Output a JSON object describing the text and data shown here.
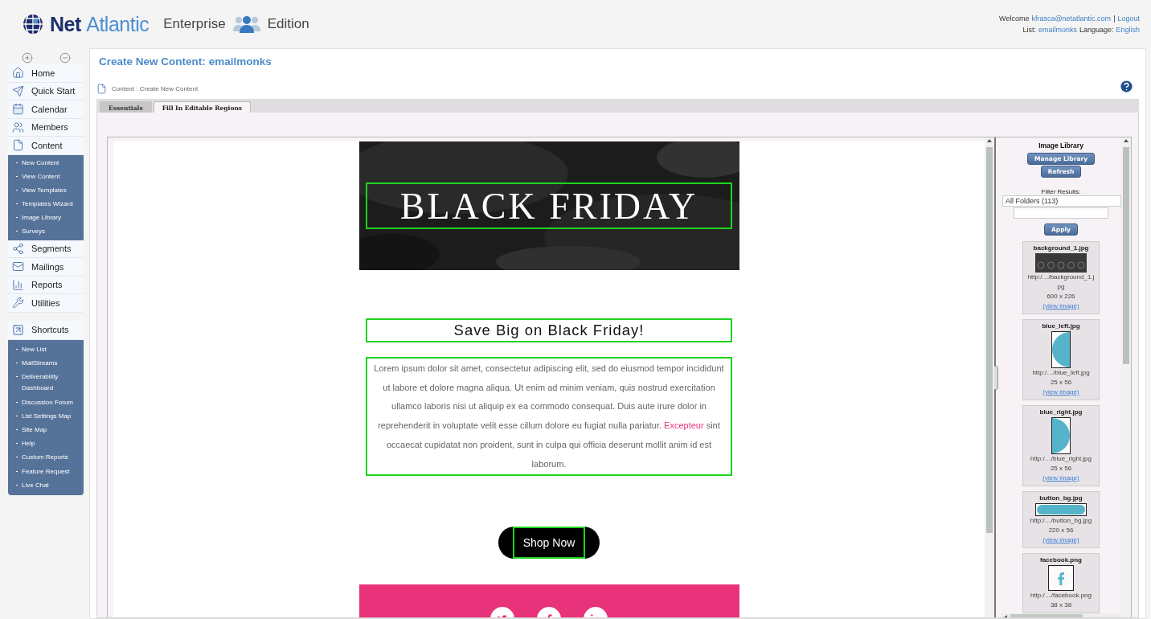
{
  "header": {
    "logo": {
      "first": "Net",
      "second": "Atlantic"
    },
    "edition": {
      "before": "Enterprise",
      "after": "Edition"
    },
    "account": {
      "welcome": "Welcome",
      "email": "kfrasca@netatlantic.com",
      "separator": "|",
      "logout": "Logout",
      "list_label": "List:",
      "list": "emailmonks",
      "language_label": "Language:",
      "language": "English"
    }
  },
  "sidebar": {
    "items": [
      {
        "label": "Home"
      },
      {
        "label": "Quick Start"
      },
      {
        "label": "Calendar"
      },
      {
        "label": "Members"
      },
      {
        "label": "Content",
        "expanded": true,
        "children": [
          "New Content",
          "View Content",
          "View Templates",
          "Templates Wizard",
          "Image Library",
          "Surveys"
        ]
      },
      {
        "label": "Segments"
      },
      {
        "label": "Mailings"
      },
      {
        "label": "Reports"
      },
      {
        "label": "Utilities"
      }
    ],
    "shortcuts": {
      "label": "Shortcuts",
      "expanded": true,
      "children": [
        "New List",
        "MailStreams",
        "Deliverability Dashboard",
        "Discussion Forum",
        "List Settings Map",
        "Site Map",
        "Help",
        "Custom Reports",
        "Feature Request",
        "Live Chat"
      ]
    }
  },
  "page": {
    "title": "Create New Content:",
    "list": "emailmonks",
    "breadcrumb": "Content : Create New Content"
  },
  "tabs": [
    {
      "label": "Essentials",
      "selected": false
    },
    {
      "label": "Fill In Editable Regions",
      "selected": true
    }
  ],
  "email": {
    "banner": "BLACK FRIDAY",
    "heading": "Save Big on Black Friday!",
    "paragraph": {
      "before": "Lorem ipsum dolor sit amet, consectetur adipiscing elit, sed do eiusmod tempor incididunt ut labore et dolore magna aliqua. Ut enim ad minim veniam, quis nostrud exercitation ullamco laboris nisi ut aliquip ex ea commodo consequat. Duis aute irure dolor in reprehenderit in voluptate velit esse cillum dolore eu fugiat nulla pariatur.",
      "link": "Excepteur",
      "after": "sint occaecat cupidatat non proident, sunt in culpa qui officia deserunt mollit anim id est laborum."
    },
    "button": "Shop Now"
  },
  "image_library": {
    "title": "Image Library",
    "manage": "Manage Library",
    "refresh": "Refresh",
    "filter_label": "Filter Results:",
    "folder": "All Folders (113)",
    "apply": "Apply",
    "images": [
      {
        "kind": "texture",
        "name": "background_1.jpg",
        "url": "http:/…/background_1.jpg",
        "size": "600 x 226",
        "view": "(view image)"
      },
      {
        "kind": "left-half",
        "name": "blue_left.jpg",
        "url": "http:/…/blue_left.jpg",
        "size": "25 x 56",
        "view": "(view image)"
      },
      {
        "kind": "right-half",
        "name": "blue_right.jpg",
        "url": "http:/…/blue_right.jpg",
        "size": "25 x 56",
        "view": "(view image)"
      },
      {
        "kind": "bar",
        "name": "button_bg.jpg",
        "url": "http:/…/button_bg.jpg",
        "size": "220 x 56",
        "view": "(view image)"
      },
      {
        "kind": "facebook",
        "name": "facebook.png",
        "url": "http:/…/facebook.png",
        "size": "38 x 38"
      }
    ]
  }
}
